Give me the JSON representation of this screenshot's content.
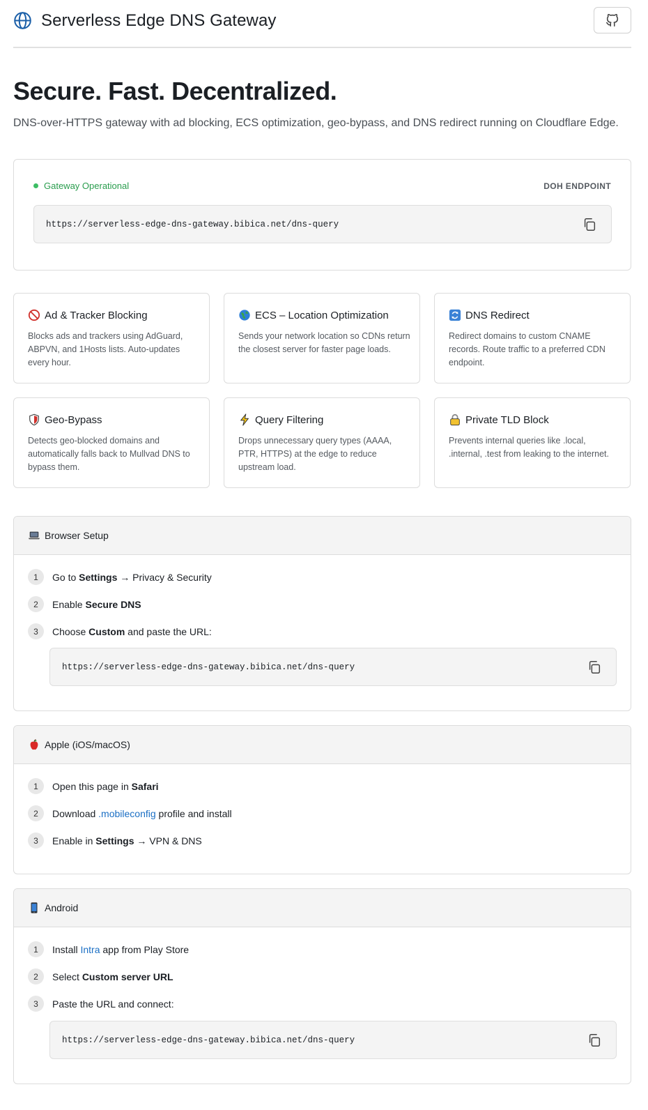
{
  "header": {
    "title": "Serverless Edge DNS Gateway",
    "github_icon": "github-icon",
    "logo_icon": "globe-icon"
  },
  "hero": {
    "title": "Secure. Fast. Decentralized.",
    "subtitle": "DNS-over-HTTPS gateway with ad blocking, ECS optimization, geo-bypass, and DNS redirect running on Cloudflare Edge."
  },
  "endpoint": {
    "status": "Gateway Operational",
    "status_color": "#3cbd64",
    "label": "DOH ENDPOINT",
    "url": "https://serverless-edge-dns-gateway.bibica.net/dns-query"
  },
  "features": [
    {
      "icon": "no-entry-icon",
      "title": "Ad & Tracker Blocking",
      "desc": "Blocks ads and trackers using AdGuard, ABPVN, and 1Hosts lists. Auto-updates every hour."
    },
    {
      "icon": "globe-americas-icon",
      "title": "ECS – Location Optimization",
      "desc": "Sends your network location so CDNs return the closest server for faster page loads."
    },
    {
      "icon": "arrows-cycle-icon",
      "title": "DNS Redirect",
      "desc": "Redirect domains to custom CNAME records. Route traffic to a preferred CDN endpoint."
    },
    {
      "icon": "shield-icon",
      "title": "Geo-Bypass",
      "desc": "Detects geo-blocked domains and automatically falls back to Mullvad DNS to bypass them."
    },
    {
      "icon": "lightning-icon",
      "title": "Query Filtering",
      "desc": "Drops unnecessary query types (AAAA, PTR, HTTPS) at the edge to reduce upstream load."
    },
    {
      "icon": "lock-icon",
      "title": "Private TLD Block",
      "desc": "Prevents internal queries like .local, .internal, .test from leaking to the internet."
    }
  ],
  "browser": {
    "icon": "laptop-icon",
    "title": "Browser Setup",
    "steps": [
      {
        "num": "1",
        "pre": "Go to ",
        "bold": "Settings",
        "post": " → Privacy & Security"
      },
      {
        "num": "2",
        "pre": "Enable ",
        "bold": "Secure DNS",
        "post": ""
      },
      {
        "num": "3",
        "pre": "Choose ",
        "bold": "Custom",
        "post": " and paste the URL:"
      }
    ],
    "url": "https://serverless-edge-dns-gateway.bibica.net/dns-query"
  },
  "apple": {
    "icon": "apple-icon",
    "title": "Apple (iOS/macOS)",
    "steps": [
      {
        "num": "1",
        "pre": "Open this page in ",
        "bold": "Safari",
        "post": ""
      },
      {
        "num": "2",
        "pre": "Download ",
        "link": ".mobileconfig",
        "post": " profile and install"
      },
      {
        "num": "3",
        "pre": "Enable in ",
        "bold": "Settings",
        "post": " → VPN & DNS"
      }
    ]
  },
  "android": {
    "icon": "mobile-phone-icon",
    "title": "Android",
    "steps": [
      {
        "num": "1",
        "pre": "Install ",
        "link": "Intra",
        "post": " app from Play Store"
      },
      {
        "num": "2",
        "pre": "Select ",
        "bold": "Custom server URL",
        "post": ""
      },
      {
        "num": "3",
        "pre": "Paste the URL and connect:",
        "bold": "",
        "post": ""
      }
    ],
    "url": "https://serverless-edge-dns-gateway.bibica.net/dns-query"
  }
}
